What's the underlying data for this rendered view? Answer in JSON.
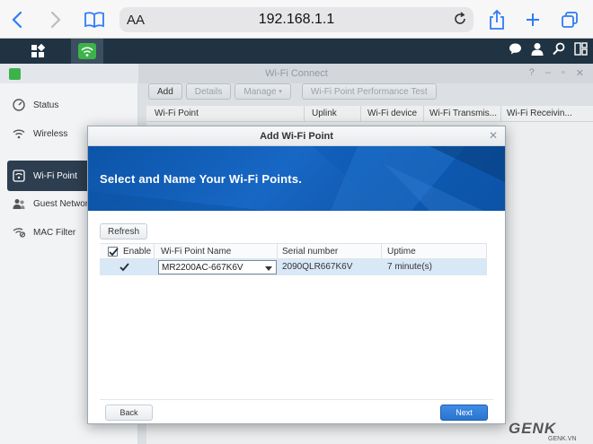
{
  "browser": {
    "url_text_size": "AA",
    "url": "192.168.1.1"
  },
  "app": {
    "title": "Wi-Fi Connect",
    "sidebar": [
      {
        "label": "Status",
        "icon": "status-icon"
      },
      {
        "label": "Wireless",
        "icon": "wifi-icon"
      },
      {
        "label": "Wi-Fi Point",
        "icon": "wifi-point-icon",
        "active": true
      },
      {
        "label": "Guest Networ",
        "icon": "guest-icon"
      },
      {
        "label": "MAC Filter",
        "icon": "mac-filter-icon"
      }
    ],
    "toolbar": {
      "add": "Add",
      "details": "Details",
      "manage": "Manage",
      "test": "Wi-Fi Point Performance Test"
    },
    "columns": [
      "Wi-Fi Point",
      "Uplink",
      "Wi-Fi device",
      "Wi-Fi Transmis...",
      "Wi-Fi Receivin..."
    ]
  },
  "dialog": {
    "title": "Add Wi-Fi Point",
    "banner": "Select and Name Your Wi-Fi Points.",
    "refresh": "Refresh",
    "columns": {
      "enable": "Enable",
      "name": "Wi-Fi Point Name",
      "serial": "Serial number",
      "uptime": "Uptime"
    },
    "row": {
      "enabled": true,
      "name": "MR2200AC-667K6V",
      "serial": "2090QLR667K6V",
      "uptime": "7 minute(s)"
    },
    "back": "Back",
    "next": "Next"
  },
  "watermark": {
    "main": "GENK",
    "sub": "GENK.VN"
  },
  "colors": {
    "accent": "#2f7cf6",
    "dsm_bar": "#1f3342",
    "sidebar_active": "#2c3e50",
    "banner": "#1767c4",
    "next": "#2a74cf"
  }
}
